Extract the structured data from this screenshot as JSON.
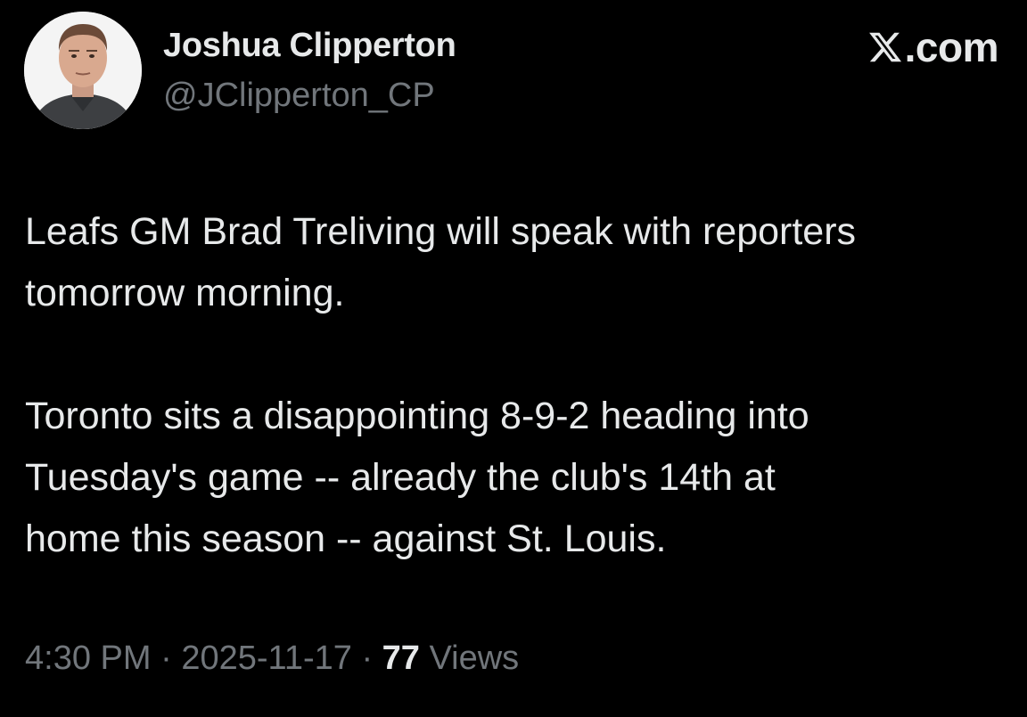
{
  "author": {
    "display_name": "Joshua Clipperton",
    "handle": "@JClipperton_CP"
  },
  "brand": {
    "logo_icon": "x-logo-icon",
    "suffix": ".com"
  },
  "tweet": {
    "paragraphs": [
      "Leafs GM Brad Treliving will speak with reporters\ntomorrow morning.",
      "Toronto sits a disappointing 8-9-2 heading into\nTuesday's game -- already the club's 14th at\nhome this season -- against St. Louis."
    ]
  },
  "meta": {
    "time": "4:30 PM",
    "date": "2025-11-17",
    "separator": "·",
    "views_count": "77",
    "views_label": "Views"
  },
  "colors": {
    "background": "#000000",
    "primary_text": "#e7e9ea",
    "secondary_text": "#71767b"
  }
}
